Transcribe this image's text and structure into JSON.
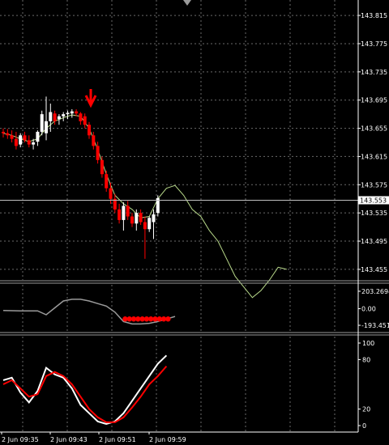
{
  "main_pane": {
    "price_labels": [
      "143.815",
      "143.775",
      "143.735",
      "143.695",
      "143.655",
      "143.615",
      "143.575",
      "143.535",
      "143.495",
      "143.455"
    ],
    "current_price": "143.553",
    "colors": {
      "bear": "#ff0000",
      "bull": "#ffffff",
      "ma": "#b8d98a",
      "background": "#000000",
      "grid": "#6a6a6a",
      "current_line": "#c0c0c0",
      "arrow": "#ff0000"
    },
    "signal_marker": "down-arrow"
  },
  "cci_pane": {
    "labels": [
      "203.2694",
      "0.00",
      "-193.4514"
    ],
    "colors": {
      "line": "#9a9a9a",
      "dots": "#ff0000"
    }
  },
  "stoch_pane": {
    "labels": [
      "100",
      "80",
      "20",
      "0"
    ],
    "colors": {
      "main": "#ffffff",
      "signal": "#ff0000"
    }
  },
  "time_axis": {
    "labels": [
      "2 Jun 09:35",
      "2 Jun 09:43",
      "2 Jun 09:51",
      "2 Jun 09:59"
    ]
  },
  "chart_data": {
    "type": "candlestick",
    "price_range": [
      143.44,
      143.83
    ],
    "candles": [
      {
        "o": 143.65,
        "h": 143.655,
        "l": 143.642,
        "c": 143.648
      },
      {
        "o": 143.648,
        "h": 143.654,
        "l": 143.64,
        "c": 143.645
      },
      {
        "o": 143.645,
        "h": 143.652,
        "l": 143.635,
        "c": 143.64
      },
      {
        "o": 143.64,
        "h": 143.65,
        "l": 143.625,
        "c": 143.63
      },
      {
        "o": 143.632,
        "h": 143.648,
        "l": 143.628,
        "c": 143.645
      },
      {
        "o": 143.645,
        "h": 143.65,
        "l": 143.635,
        "c": 143.638
      },
      {
        "o": 143.638,
        "h": 143.645,
        "l": 143.628,
        "c": 143.632
      },
      {
        "o": 143.632,
        "h": 143.64,
        "l": 143.625,
        "c": 143.635
      },
      {
        "o": 143.636,
        "h": 143.652,
        "l": 143.63,
        "c": 143.65
      },
      {
        "o": 143.65,
        "h": 143.68,
        "l": 143.645,
        "c": 143.675
      },
      {
        "o": 143.648,
        "h": 143.7,
        "l": 143.638,
        "c": 143.665
      },
      {
        "o": 143.665,
        "h": 143.69,
        "l": 143.65,
        "c": 143.678
      },
      {
        "o": 143.676,
        "h": 143.68,
        "l": 143.66,
        "c": 143.665
      },
      {
        "o": 143.668,
        "h": 143.675,
        "l": 143.66,
        "c": 143.672
      },
      {
        "o": 143.672,
        "h": 143.678,
        "l": 143.665,
        "c": 143.675
      },
      {
        "o": 143.675,
        "h": 143.68,
        "l": 143.668,
        "c": 143.677
      },
      {
        "o": 143.676,
        "h": 143.682,
        "l": 143.67,
        "c": 143.679
      },
      {
        "o": 143.679,
        "h": 143.682,
        "l": 143.672,
        "c": 143.676
      },
      {
        "o": 143.676,
        "h": 143.678,
        "l": 143.66,
        "c": 143.665
      },
      {
        "o": 143.672,
        "h": 143.676,
        "l": 143.655,
        "c": 143.66
      },
      {
        "o": 143.66,
        "h": 143.664,
        "l": 143.64,
        "c": 143.645
      },
      {
        "o": 143.645,
        "h": 143.65,
        "l": 143.625,
        "c": 143.63
      },
      {
        "o": 143.63,
        "h": 143.636,
        "l": 143.605,
        "c": 143.61
      },
      {
        "o": 143.61,
        "h": 143.615,
        "l": 143.585,
        "c": 143.59
      },
      {
        "o": 143.59,
        "h": 143.595,
        "l": 143.565,
        "c": 143.57
      },
      {
        "o": 143.57,
        "h": 143.578,
        "l": 143.548,
        "c": 143.555
      },
      {
        "o": 143.555,
        "h": 143.562,
        "l": 143.535,
        "c": 143.54
      },
      {
        "o": 143.54,
        "h": 143.548,
        "l": 143.52,
        "c": 143.525
      },
      {
        "o": 143.525,
        "h": 143.55,
        "l": 143.51,
        "c": 143.545
      },
      {
        "o": 143.545,
        "h": 143.552,
        "l": 143.525,
        "c": 143.53
      },
      {
        "o": 143.53,
        "h": 143.535,
        "l": 143.515,
        "c": 143.52
      },
      {
        "o": 143.52,
        "h": 143.54,
        "l": 143.51,
        "c": 143.535
      },
      {
        "o": 143.535,
        "h": 143.54,
        "l": 143.518,
        "c": 143.522
      },
      {
        "o": 143.522,
        "h": 143.53,
        "l": 143.47,
        "c": 143.512
      },
      {
        "o": 143.512,
        "h": 143.53,
        "l": 143.508,
        "c": 143.528
      },
      {
        "o": 143.522,
        "h": 143.54,
        "l": 143.498,
        "c": 143.533
      },
      {
        "o": 143.535,
        "h": 143.56,
        "l": 143.53,
        "c": 143.556
      }
    ],
    "ma_line": [
      [
        0,
        143.648
      ],
      [
        2,
        143.645
      ],
      [
        4,
        143.64
      ],
      [
        6,
        143.636
      ],
      [
        8,
        143.64
      ],
      [
        10,
        143.655
      ],
      [
        12,
        143.665
      ],
      [
        14,
        143.67
      ],
      [
        16,
        143.674
      ],
      [
        18,
        143.672
      ],
      [
        20,
        143.655
      ],
      [
        22,
        143.625
      ],
      [
        24,
        143.59
      ],
      [
        26,
        143.56
      ],
      [
        28,
        143.548
      ],
      [
        30,
        143.54
      ],
      [
        32,
        143.528
      ],
      [
        34,
        143.53
      ],
      [
        36,
        143.555
      ],
      [
        38,
        143.57
      ],
      [
        40,
        143.574
      ],
      [
        42,
        143.56
      ],
      [
        44,
        143.54
      ],
      [
        46,
        143.53
      ],
      [
        48,
        143.51
      ],
      [
        50,
        143.495
      ],
      [
        52,
        143.47
      ],
      [
        54,
        143.445
      ],
      [
        56,
        143.43
      ],
      [
        58,
        143.415
      ],
      [
        60,
        143.425
      ],
      [
        62,
        143.44
      ],
      [
        64,
        143.458
      ],
      [
        66,
        143.455
      ]
    ],
    "cci": [
      [
        0,
        -20
      ],
      [
        4,
        -25
      ],
      [
        8,
        -25
      ],
      [
        10,
        -70
      ],
      [
        12,
        10
      ],
      [
        14,
        90
      ],
      [
        16,
        110
      ],
      [
        18,
        110
      ],
      [
        20,
        90
      ],
      [
        22,
        60
      ],
      [
        24,
        30
      ],
      [
        26,
        -40
      ],
      [
        28,
        -150
      ],
      [
        30,
        -178
      ],
      [
        32,
        -178
      ],
      [
        34,
        -170
      ],
      [
        36,
        -150
      ],
      [
        38,
        -120
      ],
      [
        40,
        -90
      ]
    ],
    "cci_dots": [
      28,
      29,
      30,
      31,
      32,
      33,
      34,
      35,
      36,
      37,
      38
    ],
    "cci_dot_level": -120,
    "stoch_main": [
      [
        0,
        55
      ],
      [
        2,
        58
      ],
      [
        4,
        40
      ],
      [
        6,
        28
      ],
      [
        8,
        42
      ],
      [
        10,
        70
      ],
      [
        12,
        62
      ],
      [
        14,
        58
      ],
      [
        16,
        45
      ],
      [
        18,
        25
      ],
      [
        20,
        15
      ],
      [
        22,
        5
      ],
      [
        24,
        2
      ],
      [
        26,
        5
      ],
      [
        28,
        15
      ],
      [
        30,
        30
      ],
      [
        32,
        45
      ],
      [
        34,
        60
      ],
      [
        36,
        75
      ],
      [
        38,
        85
      ]
    ],
    "stoch_signal": [
      [
        0,
        50
      ],
      [
        2,
        55
      ],
      [
        4,
        45
      ],
      [
        6,
        35
      ],
      [
        8,
        38
      ],
      [
        10,
        60
      ],
      [
        12,
        65
      ],
      [
        14,
        60
      ],
      [
        16,
        50
      ],
      [
        18,
        35
      ],
      [
        20,
        20
      ],
      [
        22,
        10
      ],
      [
        24,
        4
      ],
      [
        26,
        4
      ],
      [
        28,
        10
      ],
      [
        30,
        22
      ],
      [
        32,
        35
      ],
      [
        34,
        50
      ],
      [
        36,
        60
      ],
      [
        38,
        72
      ]
    ]
  }
}
